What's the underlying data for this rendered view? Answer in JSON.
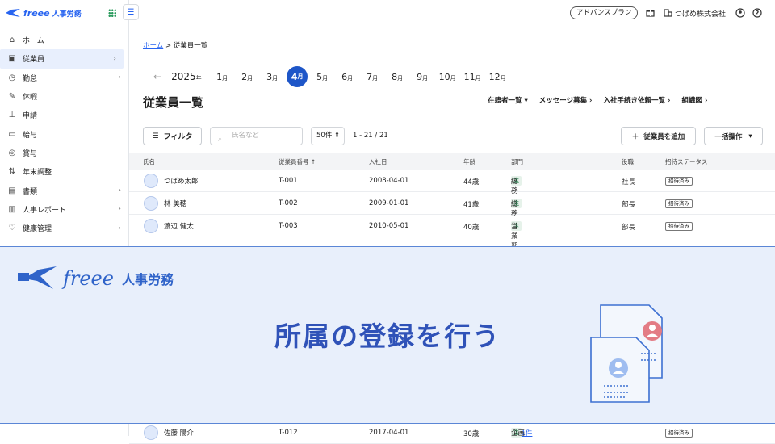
{
  "app": {
    "logo_text": "freee",
    "logo_product": "人事労務"
  },
  "sidebar": {
    "items": [
      {
        "label": "ホーム",
        "icon": "home-icon",
        "chevron": false
      },
      {
        "label": "従業員",
        "icon": "employee-icon",
        "chevron": true,
        "active": true
      },
      {
        "label": "勤怠",
        "icon": "attendance-icon",
        "chevron": true
      },
      {
        "label": "休暇",
        "icon": "leave-icon",
        "chevron": false
      },
      {
        "label": "申請",
        "icon": "stamp-icon",
        "chevron": false
      },
      {
        "label": "給与",
        "icon": "payroll-icon",
        "chevron": false
      },
      {
        "label": "賞与",
        "icon": "bonus-icon",
        "chevron": false
      },
      {
        "label": "年末調整",
        "icon": "adjust-icon",
        "chevron": false
      },
      {
        "label": "書類",
        "icon": "document-icon",
        "chevron": true
      },
      {
        "label": "人事レポート",
        "icon": "report-icon",
        "chevron": true
      },
      {
        "label": "健康管理",
        "icon": "health-icon",
        "chevron": true
      }
    ]
  },
  "header": {
    "plan": "アドバンスプラン",
    "company": "つばめ株式会社"
  },
  "breadcrumb": {
    "home": "ホーム",
    "sep": ">",
    "current": "従業員一覧"
  },
  "months": {
    "year": "2025",
    "year_unit": "年",
    "month_unit": "月",
    "list": [
      "1",
      "2",
      "3",
      "4",
      "5",
      "6",
      "7",
      "8",
      "9",
      "10",
      "11",
      "12"
    ],
    "selected": "4"
  },
  "page": {
    "title": "従業員一覧",
    "links": [
      "在籍者一覧 ▾",
      "メッセージ募集 ›",
      "入社手続き依頼一覧 ›",
      "組織図 ›"
    ]
  },
  "toolbar": {
    "filter": "フィルタ",
    "search_placeholder": "氏名など",
    "per_page": "50件 ⇕",
    "count": "1 - 21 / 21",
    "add": "従業員を追加",
    "bulk": "一括操作"
  },
  "table": {
    "headers": [
      "氏名",
      "従業員番号 ↑",
      "入社日",
      "年齢",
      "部門",
      "役職",
      "招待ステータス"
    ],
    "rows": [
      {
        "name": "つばめ太郎",
        "id": "T-001",
        "date": "2008-04-01",
        "age": "44歳",
        "tag": "主",
        "dept": "総務",
        "extra": "",
        "title": "社長",
        "status": "招待済み"
      },
      {
        "name": "林 美穂",
        "id": "T-002",
        "date": "2009-01-01",
        "age": "41歳",
        "tag": "主",
        "dept": "総務",
        "extra": "",
        "title": "部長",
        "status": "招待済み"
      },
      {
        "name": "渡辺 健太",
        "id": "T-003",
        "date": "2010-05-01",
        "age": "40歳",
        "tag": "主",
        "dept": "営業部",
        "extra": "",
        "title": "部長",
        "status": "招待済み"
      },
      {
        "name": "佐藤 陽介",
        "id": "T-012",
        "date": "2017-04-01",
        "age": "30歳",
        "tag": "主",
        "dept": "企画",
        "extra": "他1件",
        "title": "",
        "status": "招待済み"
      }
    ]
  },
  "banner": {
    "brand": "freee",
    "brand_product": "人事労務",
    "headline": "所属の登録を行う"
  }
}
